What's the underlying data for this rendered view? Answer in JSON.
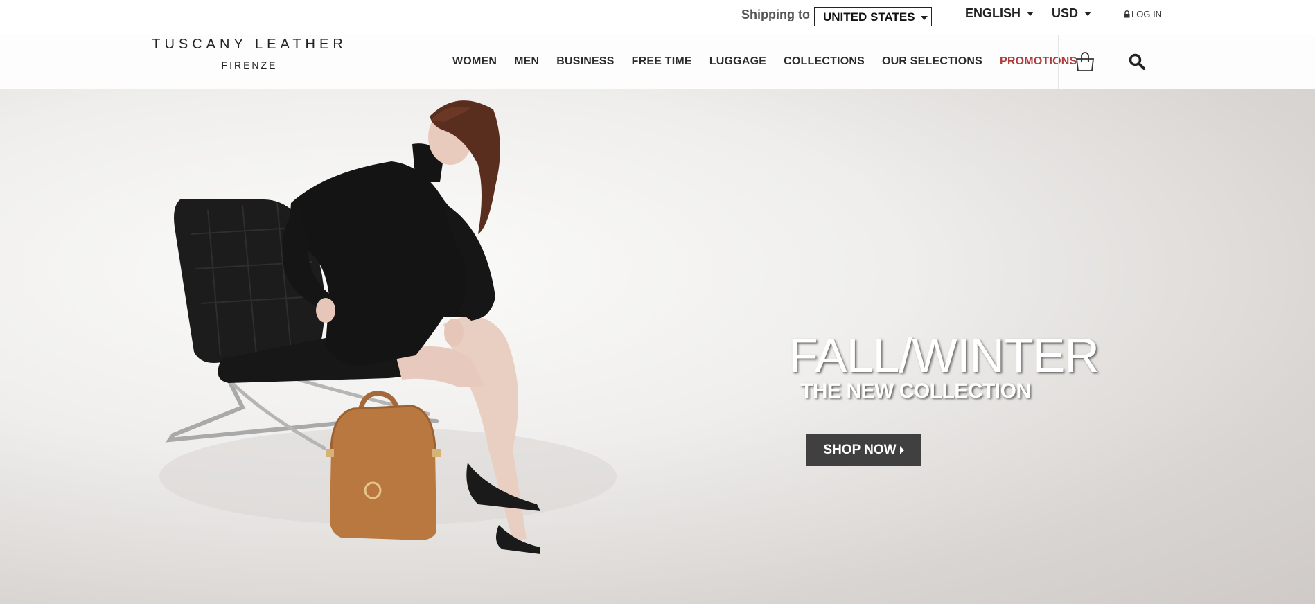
{
  "topbar": {
    "shipping_label": "Shipping to",
    "shipping_country": "UNITED STATES",
    "language": "ENGLISH",
    "currency": "USD",
    "login": "LOG IN"
  },
  "brand": {
    "name": "TUSCANY LEATHER",
    "city": "FIRENZE"
  },
  "nav": {
    "items": [
      "WOMEN",
      "MEN",
      "BUSINESS",
      "FREE TIME",
      "LUGGAGE",
      "COLLECTIONS",
      "OUR SELECTIONS",
      "PROMOTIONS"
    ],
    "cart_icon": "shopping-bag-icon",
    "search_icon": "search-icon"
  },
  "hero": {
    "title": "FALL/WINTER",
    "subtitle": "THE NEW COLLECTION",
    "cta": "SHOP NOW"
  },
  "colors": {
    "promo": "#b03a3a",
    "cta_bg": "#404040",
    "text_dark": "#2b2b2b"
  }
}
